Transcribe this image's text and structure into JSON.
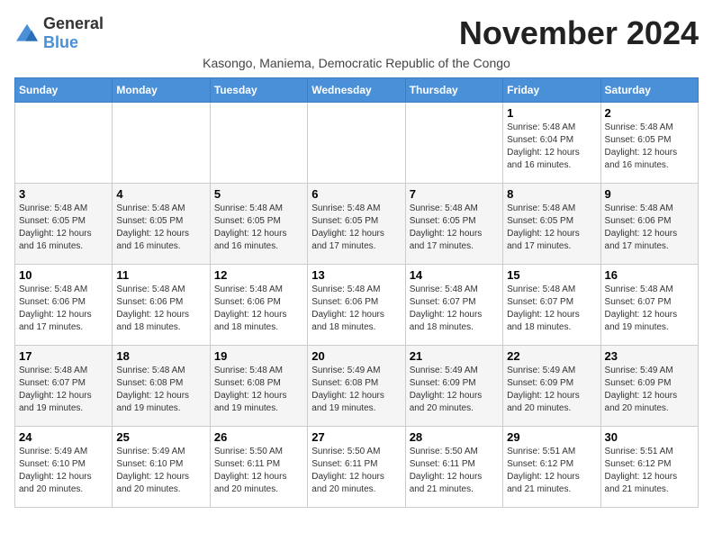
{
  "header": {
    "logo_general": "General",
    "logo_blue": "Blue",
    "month_title": "November 2024",
    "subtitle": "Kasongo, Maniema, Democratic Republic of the Congo"
  },
  "weekdays": [
    "Sunday",
    "Monday",
    "Tuesday",
    "Wednesday",
    "Thursday",
    "Friday",
    "Saturday"
  ],
  "weeks": [
    [
      {
        "day": "",
        "sunrise": "",
        "sunset": "",
        "daylight": ""
      },
      {
        "day": "",
        "sunrise": "",
        "sunset": "",
        "daylight": ""
      },
      {
        "day": "",
        "sunrise": "",
        "sunset": "",
        "daylight": ""
      },
      {
        "day": "",
        "sunrise": "",
        "sunset": "",
        "daylight": ""
      },
      {
        "day": "",
        "sunrise": "",
        "sunset": "",
        "daylight": ""
      },
      {
        "day": "1",
        "sunrise": "Sunrise: 5:48 AM",
        "sunset": "Sunset: 6:04 PM",
        "daylight": "Daylight: 12 hours and 16 minutes."
      },
      {
        "day": "2",
        "sunrise": "Sunrise: 5:48 AM",
        "sunset": "Sunset: 6:05 PM",
        "daylight": "Daylight: 12 hours and 16 minutes."
      }
    ],
    [
      {
        "day": "3",
        "sunrise": "Sunrise: 5:48 AM",
        "sunset": "Sunset: 6:05 PM",
        "daylight": "Daylight: 12 hours and 16 minutes."
      },
      {
        "day": "4",
        "sunrise": "Sunrise: 5:48 AM",
        "sunset": "Sunset: 6:05 PM",
        "daylight": "Daylight: 12 hours and 16 minutes."
      },
      {
        "day": "5",
        "sunrise": "Sunrise: 5:48 AM",
        "sunset": "Sunset: 6:05 PM",
        "daylight": "Daylight: 12 hours and 16 minutes."
      },
      {
        "day": "6",
        "sunrise": "Sunrise: 5:48 AM",
        "sunset": "Sunset: 6:05 PM",
        "daylight": "Daylight: 12 hours and 17 minutes."
      },
      {
        "day": "7",
        "sunrise": "Sunrise: 5:48 AM",
        "sunset": "Sunset: 6:05 PM",
        "daylight": "Daylight: 12 hours and 17 minutes."
      },
      {
        "day": "8",
        "sunrise": "Sunrise: 5:48 AM",
        "sunset": "Sunset: 6:05 PM",
        "daylight": "Daylight: 12 hours and 17 minutes."
      },
      {
        "day": "9",
        "sunrise": "Sunrise: 5:48 AM",
        "sunset": "Sunset: 6:06 PM",
        "daylight": "Daylight: 12 hours and 17 minutes."
      }
    ],
    [
      {
        "day": "10",
        "sunrise": "Sunrise: 5:48 AM",
        "sunset": "Sunset: 6:06 PM",
        "daylight": "Daylight: 12 hours and 17 minutes."
      },
      {
        "day": "11",
        "sunrise": "Sunrise: 5:48 AM",
        "sunset": "Sunset: 6:06 PM",
        "daylight": "Daylight: 12 hours and 18 minutes."
      },
      {
        "day": "12",
        "sunrise": "Sunrise: 5:48 AM",
        "sunset": "Sunset: 6:06 PM",
        "daylight": "Daylight: 12 hours and 18 minutes."
      },
      {
        "day": "13",
        "sunrise": "Sunrise: 5:48 AM",
        "sunset": "Sunset: 6:06 PM",
        "daylight": "Daylight: 12 hours and 18 minutes."
      },
      {
        "day": "14",
        "sunrise": "Sunrise: 5:48 AM",
        "sunset": "Sunset: 6:07 PM",
        "daylight": "Daylight: 12 hours and 18 minutes."
      },
      {
        "day": "15",
        "sunrise": "Sunrise: 5:48 AM",
        "sunset": "Sunset: 6:07 PM",
        "daylight": "Daylight: 12 hours and 18 minutes."
      },
      {
        "day": "16",
        "sunrise": "Sunrise: 5:48 AM",
        "sunset": "Sunset: 6:07 PM",
        "daylight": "Daylight: 12 hours and 19 minutes."
      }
    ],
    [
      {
        "day": "17",
        "sunrise": "Sunrise: 5:48 AM",
        "sunset": "Sunset: 6:07 PM",
        "daylight": "Daylight: 12 hours and 19 minutes."
      },
      {
        "day": "18",
        "sunrise": "Sunrise: 5:48 AM",
        "sunset": "Sunset: 6:08 PM",
        "daylight": "Daylight: 12 hours and 19 minutes."
      },
      {
        "day": "19",
        "sunrise": "Sunrise: 5:48 AM",
        "sunset": "Sunset: 6:08 PM",
        "daylight": "Daylight: 12 hours and 19 minutes."
      },
      {
        "day": "20",
        "sunrise": "Sunrise: 5:49 AM",
        "sunset": "Sunset: 6:08 PM",
        "daylight": "Daylight: 12 hours and 19 minutes."
      },
      {
        "day": "21",
        "sunrise": "Sunrise: 5:49 AM",
        "sunset": "Sunset: 6:09 PM",
        "daylight": "Daylight: 12 hours and 20 minutes."
      },
      {
        "day": "22",
        "sunrise": "Sunrise: 5:49 AM",
        "sunset": "Sunset: 6:09 PM",
        "daylight": "Daylight: 12 hours and 20 minutes."
      },
      {
        "day": "23",
        "sunrise": "Sunrise: 5:49 AM",
        "sunset": "Sunset: 6:09 PM",
        "daylight": "Daylight: 12 hours and 20 minutes."
      }
    ],
    [
      {
        "day": "24",
        "sunrise": "Sunrise: 5:49 AM",
        "sunset": "Sunset: 6:10 PM",
        "daylight": "Daylight: 12 hours and 20 minutes."
      },
      {
        "day": "25",
        "sunrise": "Sunrise: 5:49 AM",
        "sunset": "Sunset: 6:10 PM",
        "daylight": "Daylight: 12 hours and 20 minutes."
      },
      {
        "day": "26",
        "sunrise": "Sunrise: 5:50 AM",
        "sunset": "Sunset: 6:11 PM",
        "daylight": "Daylight: 12 hours and 20 minutes."
      },
      {
        "day": "27",
        "sunrise": "Sunrise: 5:50 AM",
        "sunset": "Sunset: 6:11 PM",
        "daylight": "Daylight: 12 hours and 20 minutes."
      },
      {
        "day": "28",
        "sunrise": "Sunrise: 5:50 AM",
        "sunset": "Sunset: 6:11 PM",
        "daylight": "Daylight: 12 hours and 21 minutes."
      },
      {
        "day": "29",
        "sunrise": "Sunrise: 5:51 AM",
        "sunset": "Sunset: 6:12 PM",
        "daylight": "Daylight: 12 hours and 21 minutes."
      },
      {
        "day": "30",
        "sunrise": "Sunrise: 5:51 AM",
        "sunset": "Sunset: 6:12 PM",
        "daylight": "Daylight: 12 hours and 21 minutes."
      }
    ]
  ]
}
